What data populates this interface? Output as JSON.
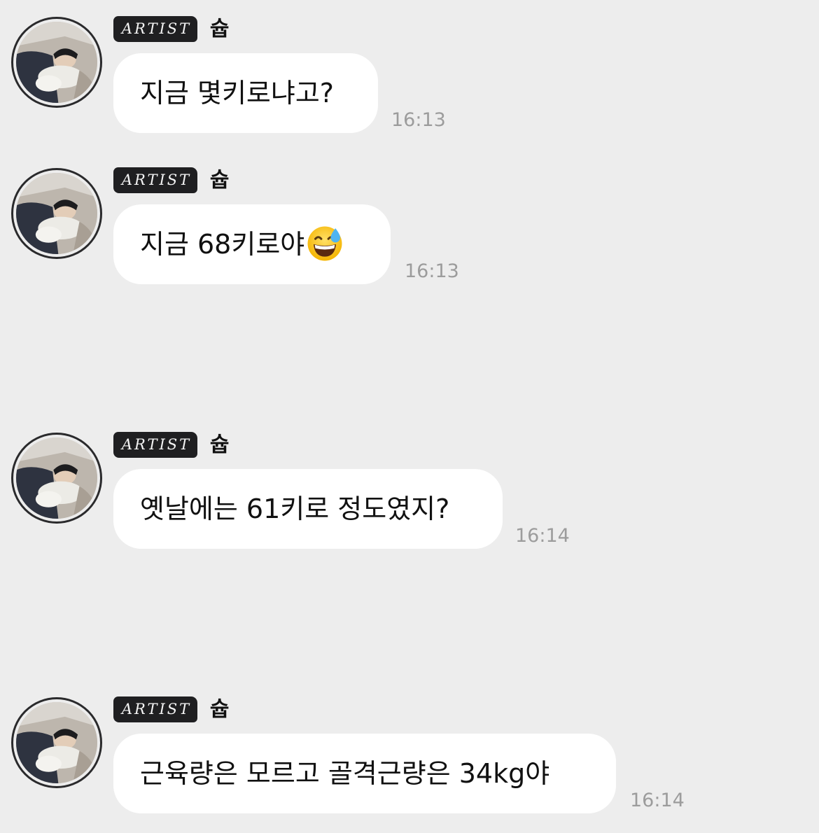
{
  "messages": [
    {
      "badge": "ARTIST",
      "sender": "슙",
      "text": "지금 몇키로냐고?",
      "emoji": "",
      "time": "16:13"
    },
    {
      "badge": "ARTIST",
      "sender": "슙",
      "text": "지금 68키로야",
      "emoji": "grinning-face-with-sweat",
      "time": "16:13"
    },
    {
      "badge": "ARTIST",
      "sender": "슙",
      "text": "옛날에는 61키로 정도였지?",
      "emoji": "",
      "time": "16:14"
    },
    {
      "badge": "ARTIST",
      "sender": "슙",
      "text": "근육량은 모르고 골격근량은 34kg야",
      "emoji": "",
      "time": "16:14"
    }
  ]
}
